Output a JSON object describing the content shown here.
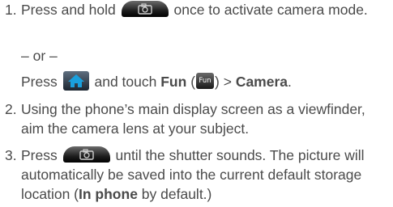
{
  "steps": [
    {
      "number": "1.",
      "part1": "Press and hold",
      "part2": "once to activate camera mode.",
      "or_text": "– or –",
      "alt": {
        "part1": "Press",
        "part2": "and touch",
        "fun_label": "Fun",
        "paren_open": "(",
        "fun_icon_text": "Fun",
        "paren_close": ") >",
        "camera_label": "Camera",
        "end": "."
      }
    },
    {
      "number": "2.",
      "text": "Using the phone’s main display screen as a viewfinder, aim the camera lens at your subject."
    },
    {
      "number": "3.",
      "part1": "Press",
      "part2": "until the shutter sounds. The picture will automatically be saved into the current default storage location (",
      "bold": "In phone",
      "part3": "by default.)"
    }
  ],
  "icons": {
    "camera_key": "camera-key-icon",
    "home_key": "home-key-icon",
    "fun_key": "fun-key-icon"
  },
  "colors": {
    "text": "#4a4a4a",
    "home_blue": "#1aa0dd"
  }
}
